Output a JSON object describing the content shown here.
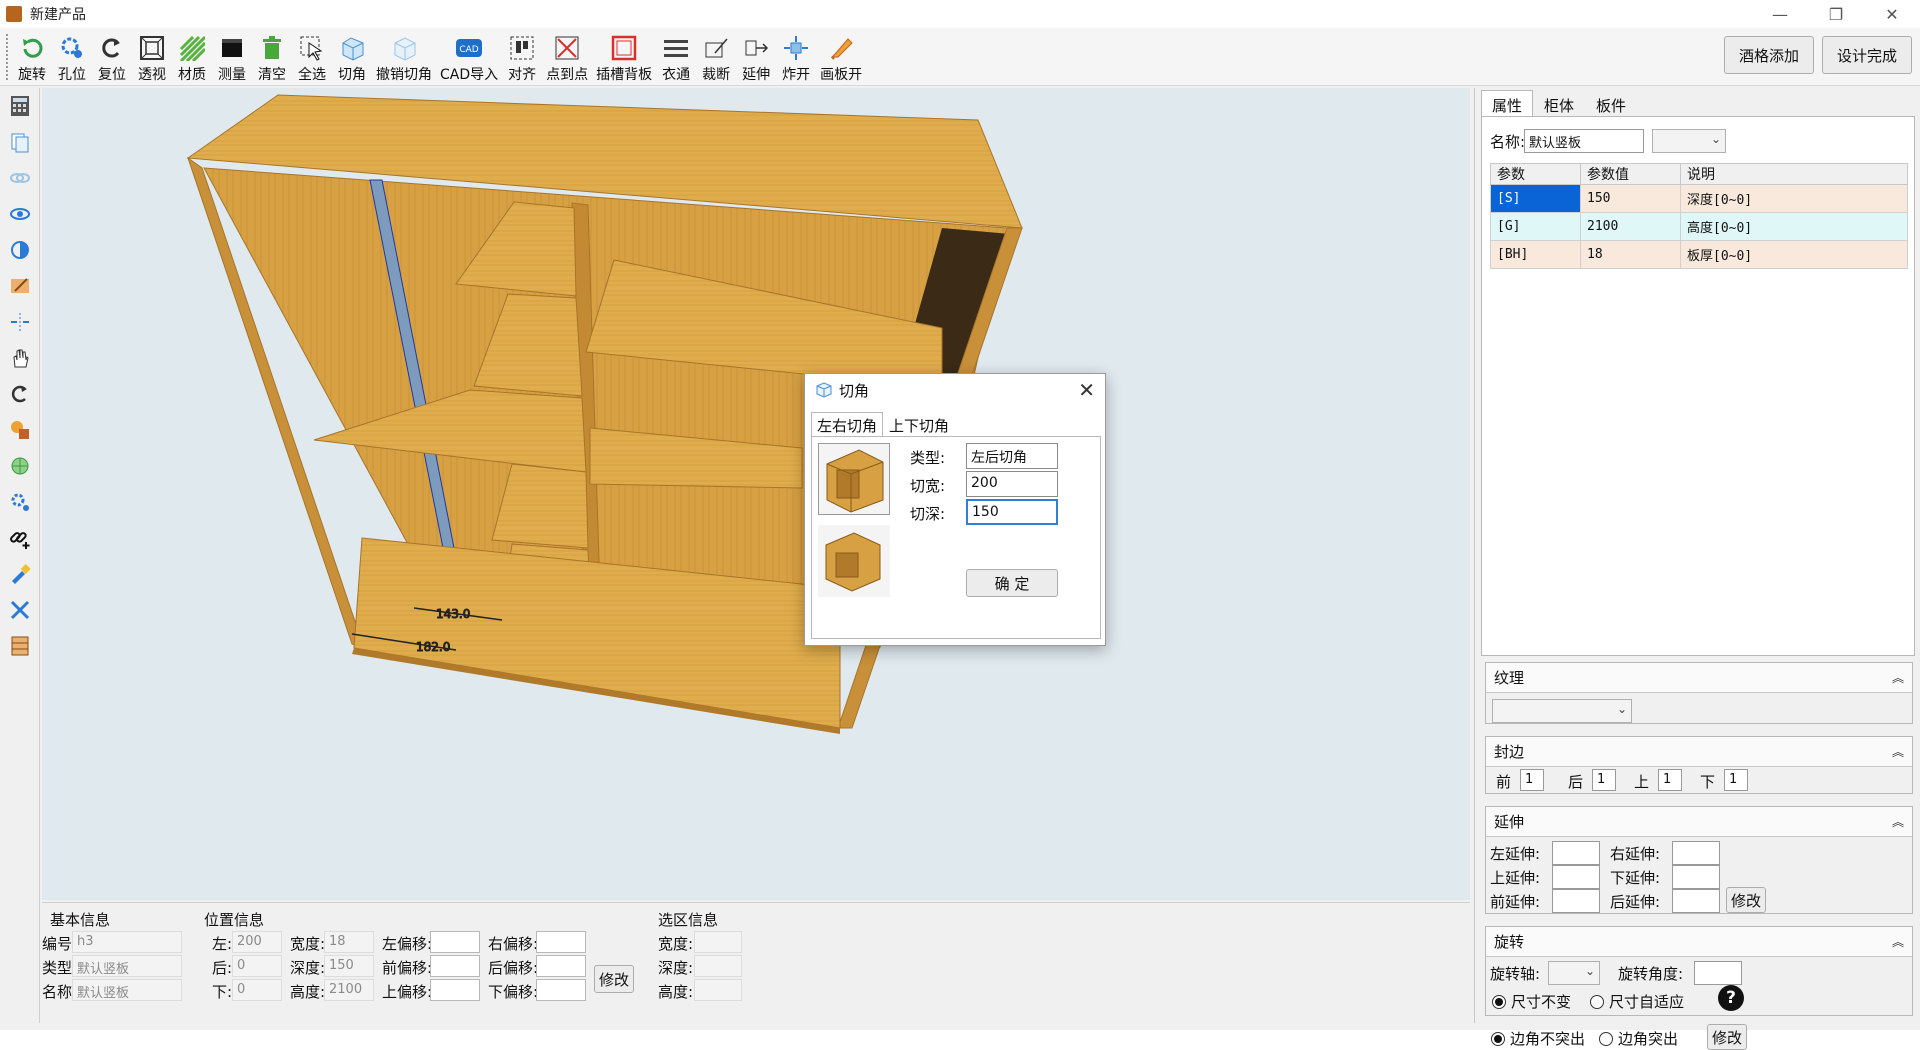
{
  "window": {
    "title": "新建产品",
    "controls": {
      "minimize": "—",
      "maximize": "❐",
      "close": "✕"
    }
  },
  "toolbar": {
    "items": [
      {
        "label": "旋转",
        "icon": "rotate-icon"
      },
      {
        "label": "孔位",
        "icon": "hole-icon"
      },
      {
        "label": "复位",
        "icon": "reset-icon"
      },
      {
        "label": "透视",
        "icon": "perspective-icon"
      },
      {
        "label": "材质",
        "icon": "material-icon"
      },
      {
        "label": "测量",
        "icon": "measure-icon"
      },
      {
        "label": "清空",
        "icon": "trash-icon"
      },
      {
        "label": "全选",
        "icon": "select-all-icon"
      },
      {
        "label": "切角",
        "icon": "cut-corner-icon"
      },
      {
        "label": "撤销切角",
        "icon": "undo-cut-corner-icon"
      },
      {
        "label": "CAD导入",
        "icon": "cad-import-icon"
      },
      {
        "label": "对齐",
        "icon": "align-icon"
      },
      {
        "label": "点到点",
        "icon": "point-to-point-icon"
      },
      {
        "label": "插槽背板",
        "icon": "slot-backboard-icon"
      },
      {
        "label": "衣通",
        "icon": "clothes-rail-icon"
      },
      {
        "label": "裁断",
        "icon": "cut-off-icon"
      },
      {
        "label": "延伸",
        "icon": "extend-icon"
      },
      {
        "label": "炸开",
        "icon": "explode-icon"
      },
      {
        "label": "画板开",
        "icon": "pencil-icon"
      }
    ],
    "right_buttons": [
      "酒格添加",
      "设计完成"
    ]
  },
  "left_tools": [
    "calculator-icon",
    "copy-icon",
    "link-icon",
    "eye-icon",
    "contrast-icon",
    "edit-board-icon",
    "split-icon",
    "hand-icon",
    "reset-view-icon",
    "shapes-icon",
    "globe-icon",
    "settings-icon",
    "chain-add-icon",
    "brush-icon",
    "tools-icon",
    "cabinet-icon"
  ],
  "viewport": {
    "dim1": "143.0",
    "dim2": "182.0"
  },
  "bottom": {
    "basic": {
      "title": "基本信息",
      "code_label": "编号:",
      "code_value": "h3",
      "type_label": "类型:",
      "type_value": "默认竖板",
      "name_label": "名称:",
      "name_value": "默认竖板"
    },
    "position": {
      "title": "位置信息",
      "left_label": "左:",
      "left_value": "200",
      "back_label": "后:",
      "back_value": "0",
      "down_label": "下:",
      "down_value": "0",
      "width_label": "宽度:",
      "width_value": "18",
      "depth_label": "深度:",
      "depth_value": "150",
      "height_label": "高度:",
      "height_value": "2100",
      "loff_label": "左偏移:",
      "roff_label": "右偏移:",
      "foff_label": "前偏移:",
      "boff_label": "后偏移:",
      "uoff_label": "上偏移:",
      "doff_label": "下偏移:",
      "modify": "修改"
    },
    "selection": {
      "title": "选区信息",
      "width_label": "宽度:",
      "depth_label": "深度:",
      "height_label": "高度:"
    }
  },
  "right": {
    "tabs": [
      "属性",
      "柜体",
      "板件"
    ],
    "name_label": "名称:",
    "name_value": "默认竖板",
    "grid": {
      "headers": [
        "参数",
        "参数值",
        "说明"
      ],
      "rows": [
        {
          "param": "[S]",
          "value": "150",
          "desc": "深度[0~0]"
        },
        {
          "param": "[G]",
          "value": "2100",
          "desc": "高度[0~0]"
        },
        {
          "param": "[BH]",
          "value": "18",
          "desc": "板厚[0~0]"
        }
      ]
    },
    "texture": {
      "title": "纹理"
    },
    "edge": {
      "title": "封边",
      "front": "前",
      "back": "后",
      "up": "上",
      "down": "下",
      "front_v": "1",
      "back_v": "1",
      "up_v": "1",
      "down_v": "1"
    },
    "extend": {
      "title": "延伸",
      "left": "左延伸:",
      "right": "右延伸:",
      "up": "上延伸:",
      "down": "下延伸:",
      "front": "前延伸:",
      "back": "后延伸:",
      "modify": "修改"
    },
    "rotate": {
      "title": "旋转",
      "axis": "旋转轴:",
      "angle": "旋转角度:",
      "opt1": "尺寸不变",
      "opt2": "尺寸自适应",
      "opt3": "边角不突出",
      "opt4": "边角突出",
      "modify": "修改",
      "help": "?"
    }
  },
  "dialog": {
    "title": "切角",
    "close": "✕",
    "tabs": [
      "左右切角",
      "上下切角"
    ],
    "type_label": "类型:",
    "type_value": "左后切角",
    "width_label": "切宽:",
    "width_value": "200",
    "depth_label": "切深:",
    "depth_value": "150",
    "ok": "确 定"
  },
  "colors": {
    "wood": "#d9a441",
    "wood_dark": "#b07a2a",
    "interior": "#3a2a16",
    "viewport_bg": "#dfe9ee",
    "accent": "#0a64d6"
  }
}
